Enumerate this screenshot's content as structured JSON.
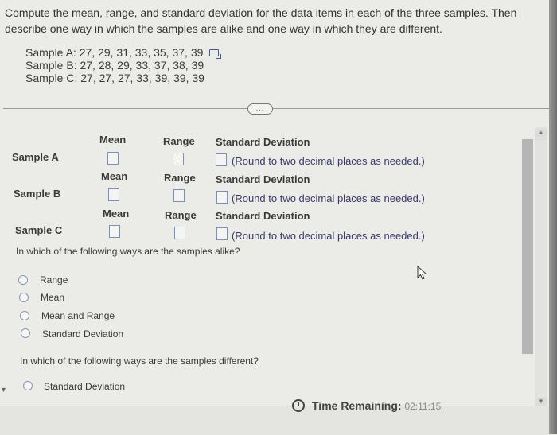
{
  "question": {
    "text": "Compute the mean, range, and standard deviation for the data items in each of the three samples. Then describe one way in which the samples are alike and one way in which they are different."
  },
  "samples": [
    {
      "label": "Sample A: 27, 29, 31, 33, 35, 37, 39"
    },
    {
      "label": "Sample B: 27, 28, 29, 33, 37, 38, 39"
    },
    {
      "label": "Sample C: 27, 27, 27, 33, 39, 39, 39"
    }
  ],
  "more_button": "...",
  "answer_grid": {
    "rows": [
      {
        "sample": "Sample A",
        "mean_label": "Mean",
        "range_label": "Range",
        "sd_label": "Standard Deviation",
        "note": "(Round to two decimal places as needed.)",
        "mean_value": "",
        "range_value": "",
        "sd_value": ""
      },
      {
        "sample": "Sample B",
        "mean_label": "Mean",
        "range_label": "Range",
        "sd_label": "Standard Deviation",
        "note": "(Round to two decimal places as needed.)",
        "mean_value": "",
        "range_value": "",
        "sd_value": ""
      },
      {
        "sample": "Sample C",
        "mean_label": "Mean",
        "range_label": "Range",
        "sd_label": "Standard Deviation",
        "note": "(Round to two decimal places as needed.)",
        "mean_value": "",
        "range_value": "",
        "sd_value": ""
      }
    ]
  },
  "alike": {
    "prompt": "In which of the following ways are the samples alike?",
    "options": [
      "Range",
      "Mean",
      "Mean and Range",
      "Standard Deviation"
    ]
  },
  "different": {
    "prompt": "In which of the following ways are the samples different?",
    "options": [
      "Standard Deviation"
    ]
  },
  "footer": {
    "time_label": "Time Remaining:",
    "time_value": "02:11:15"
  }
}
